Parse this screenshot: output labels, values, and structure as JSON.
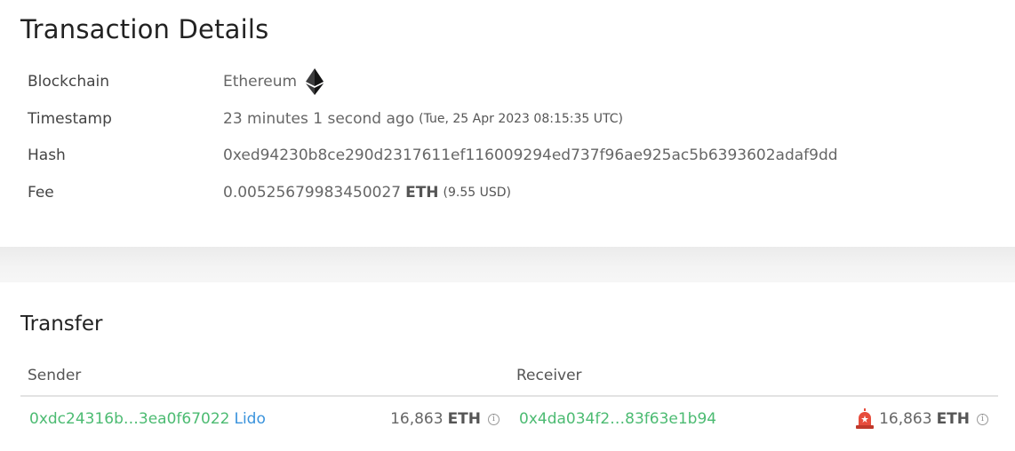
{
  "details": {
    "title": "Transaction Details",
    "rows": {
      "blockchain": {
        "label": "Blockchain",
        "value": "Ethereum",
        "icon": "ethereum-icon"
      },
      "timestamp": {
        "label": "Timestamp",
        "value": "23 minutes 1 second ago",
        "sub": "(Tue, 25 Apr 2023 08:15:35 UTC)"
      },
      "hash": {
        "label": "Hash",
        "value": "0xed94230b8ce290d2317611ef116009294ed737f96ae925ac5b6393602adaf9dd"
      },
      "fee": {
        "label": "Fee",
        "value": "0.00525679983450027",
        "unit": "ETH",
        "sub": "(9.55 USD)"
      }
    }
  },
  "transfer": {
    "title": "Transfer",
    "headers": {
      "sender": "Sender",
      "receiver": "Receiver"
    },
    "row": {
      "sender_address": "0xdc24316b…3ea0f67022",
      "sender_tag": "Lido",
      "sender_amount": "16,863",
      "sender_unit": "ETH",
      "receiver_address": "0x4da034f2…83f63e1b94",
      "receiver_amount": "16,863",
      "receiver_unit": "ETH",
      "receiver_flag_icon": "alarm-siren-icon"
    }
  },
  "colors": {
    "link_green": "#4cbb72",
    "link_blue": "#3a93dc"
  }
}
